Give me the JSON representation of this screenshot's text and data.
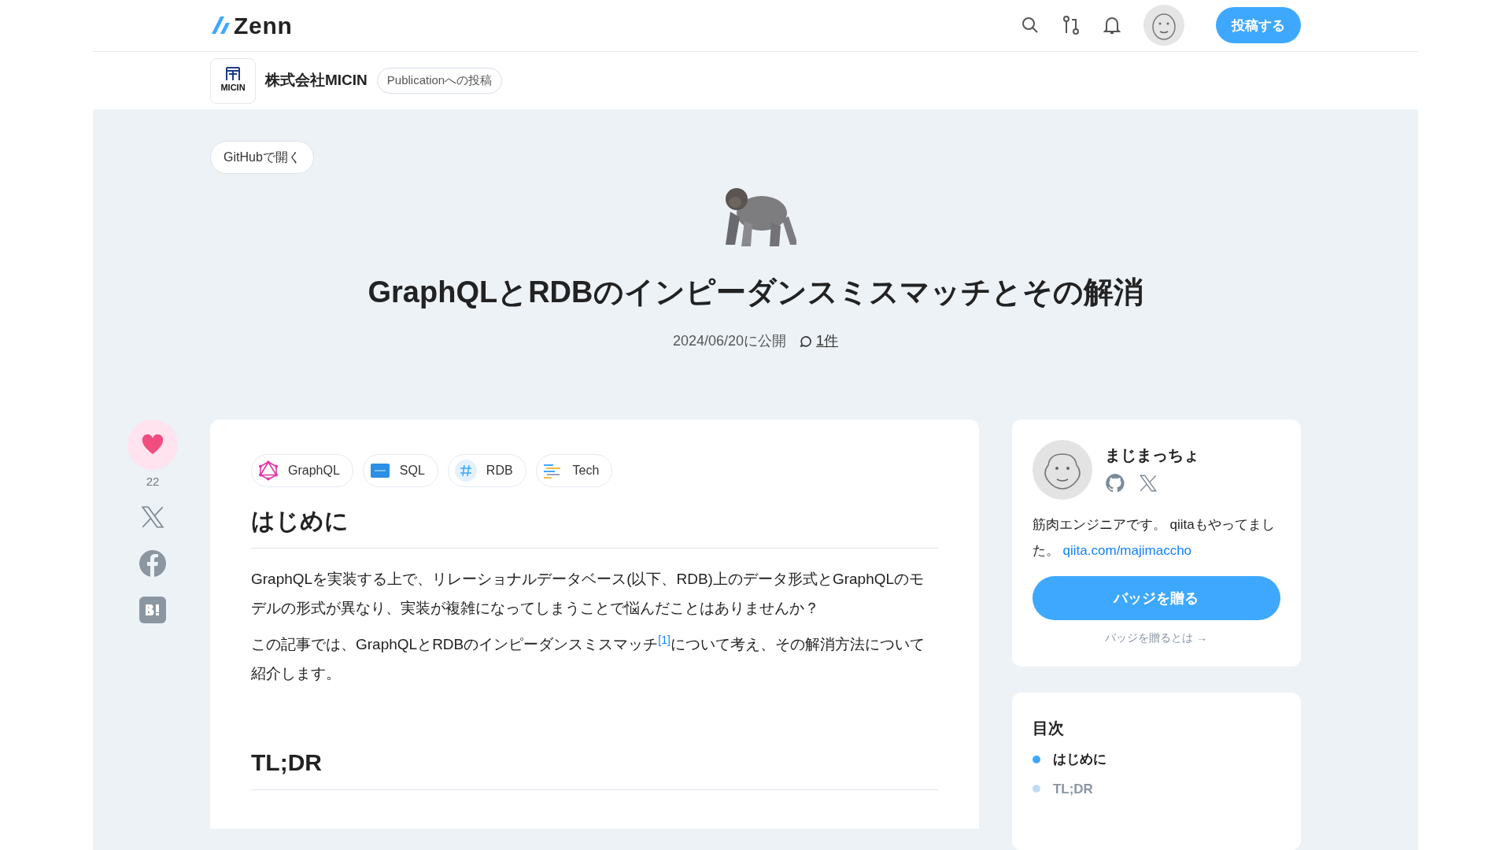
{
  "header": {
    "logo": "Zenn",
    "post_button": "投稿する"
  },
  "publication": {
    "logo_text": "MICIN",
    "name": "株式会社MICIN",
    "badge": "Publicationへの投稿"
  },
  "article": {
    "github_button": "GitHubで開く",
    "title": "GraphQLとRDBのインピーダンスミスマッチとその解消",
    "published": "2024/06/20に公開",
    "comments": "1件",
    "topics": [
      {
        "kind": "graphql",
        "label": "GraphQL"
      },
      {
        "kind": "sql",
        "label": "SQL"
      },
      {
        "kind": "hash",
        "label": "RDB"
      },
      {
        "kind": "tech",
        "label": "Tech"
      }
    ],
    "heading": "はじめに",
    "paragraphs": [
      "GraphQLを実装する上で、リレーショナルデータベース(以下、RDB)上のデータ形式とGraphQLのモデルの形式が異なり、実装が複雑になってしまうことで悩んだことはありませんか？",
      "この記事では、GraphQLとRDBのインピーダンスミスマッチ$^{[1]}$について考え、その解消方法について紹介します。"
    ],
    "heading_2": "TL;DR"
  },
  "share": {
    "liked": true,
    "likes": "22"
  },
  "author": {
    "name": "まじまっちょ",
    "bio": "筋肉エンジニアです。 qiitaもやってました。",
    "link": "qiita.com/majimaccho",
    "badge_button": "バッジを贈る",
    "badge_help": "バッジを贈るとは →"
  },
  "toc": {
    "title": "目次",
    "items": [
      {
        "label": "はじめに",
        "active": true
      },
      {
        "label": "TL;DR",
        "active": false
      }
    ]
  }
}
